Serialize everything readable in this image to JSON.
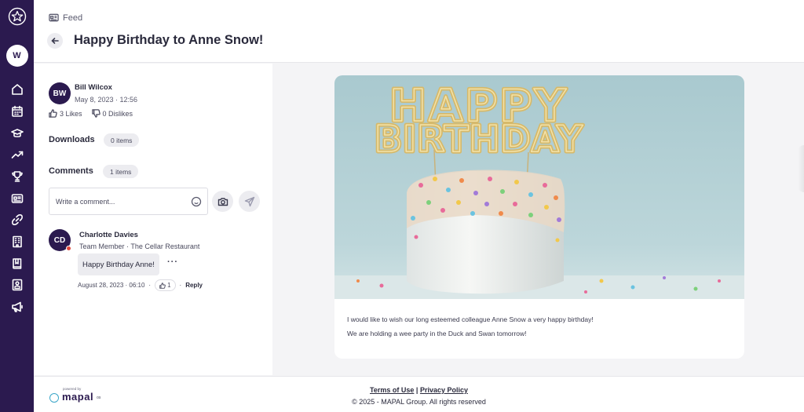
{
  "sidebar": {
    "user_initial": "W",
    "nav_icons": [
      "home-icon",
      "calendar-icon",
      "learning-icon",
      "trending-icon",
      "trophy-icon",
      "feed-icon",
      "link-icon",
      "building-icon",
      "book-icon",
      "directory-icon",
      "megaphone-icon"
    ]
  },
  "header": {
    "breadcrumb": "Feed",
    "title": "Happy Birthday to Anne Snow!"
  },
  "post": {
    "author_initials": "BW",
    "author_name": "Bill Wilcox",
    "date": "May 8, 2023 · 12:56",
    "likes": "3 Likes",
    "dislikes": "0 Dislikes",
    "downloads_label": "Downloads",
    "downloads_count": "0 items",
    "comments_label": "Comments",
    "comments_count": "1 items",
    "comment_placeholder": "Write a comment...",
    "image_text_line1": "HAPPY",
    "image_text_line2": "BIRTHDAY",
    "body_lines": [
      "I would like to wish our long esteemed colleague Anne Snow a very happy birthday!",
      "We are holding a wee party in the Duck and Swan tomorrow!"
    ]
  },
  "comments": [
    {
      "initials": "CD",
      "name": "Charlotte Davies",
      "role": "Team Member · The Cellar Restaurant",
      "text": "Happy Birthday Anne!",
      "more": "···",
      "timestamp": "August 28, 2023 · 06:10",
      "likes": "1",
      "reply_label": "Reply"
    }
  ],
  "footer": {
    "powered_by": "powered by",
    "brand": "mapal",
    "brand_suffix": "os",
    "terms": "Terms of Use",
    "separator": "|",
    "privacy": "Privacy Policy",
    "copyright": "© 2025 - MAPAL Group. All rights reserved"
  },
  "colors": {
    "sidebar": "#2b1a4f",
    "accent": "#3aa6c8",
    "online_status": "#e0473b"
  }
}
